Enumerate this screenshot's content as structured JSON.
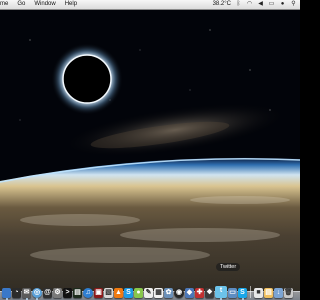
{
  "menubar": {
    "items": [
      {
        "label": "me"
      },
      {
        "label": "Go"
      },
      {
        "label": "Window"
      },
      {
        "label": "Help"
      }
    ],
    "temperature": "38.2°C"
  },
  "dock": {
    "tooltip": "Twitter",
    "items": [
      {
        "name": "finder-icon",
        "color": "#3a78c8",
        "glyph": ""
      },
      {
        "name": "dashboard-icon",
        "color": "#2b2b2b",
        "glyph": "◔"
      },
      {
        "name": "mail-icon",
        "color": "#5b5b5b",
        "glyph": "✉"
      },
      {
        "name": "safari-icon",
        "color": "#5aa0d8",
        "glyph": "◎"
      },
      {
        "name": "address-book-icon",
        "color": "#2f2f2f",
        "glyph": "@"
      },
      {
        "name": "system-preferences-icon",
        "color": "#7a7a7a",
        "glyph": "⚙"
      },
      {
        "name": "terminal-icon",
        "color": "#111111",
        "glyph": ">"
      },
      {
        "name": "activity-monitor-icon",
        "color": "#1c2b1c",
        "glyph": "▤"
      },
      {
        "name": "itunes-icon",
        "color": "#2f7fd1",
        "glyph": "♫"
      },
      {
        "name": "photo-booth-icon",
        "color": "#8c1a1a",
        "glyph": "▣"
      },
      {
        "name": "preview-icon",
        "color": "#d8d8d8",
        "glyph": "▧"
      },
      {
        "name": "vlc-icon",
        "color": "#f07a10",
        "glyph": "▲"
      },
      {
        "name": "skype-icon",
        "color": "#1d9be6",
        "glyph": "S"
      },
      {
        "name": "adium-icon",
        "color": "#88c64c",
        "glyph": "●"
      },
      {
        "name": "textedit-icon",
        "color": "#eeeeee",
        "glyph": "✎"
      },
      {
        "name": "calendar-icon",
        "color": "#f2f2f2",
        "glyph": "▦"
      },
      {
        "name": "iphoto-icon",
        "color": "#6a8fb8",
        "glyph": "✿"
      },
      {
        "name": "aperture-icon",
        "color": "#262626",
        "glyph": "◉"
      },
      {
        "name": "app-icon",
        "color": "#4b77b8",
        "glyph": "◆"
      },
      {
        "name": "app-icon",
        "color": "#c03030",
        "glyph": "✚"
      },
      {
        "name": "app-icon",
        "color": "#3b3b3b",
        "glyph": "❖"
      },
      {
        "name": "twitter-icon",
        "color": "#6cc3ea",
        "glyph": "t"
      },
      {
        "name": "monitor-icon",
        "color": "#5e8dc2",
        "glyph": "▭"
      },
      {
        "name": "skype-icon",
        "color": "#1aa7e8",
        "glyph": "S"
      },
      {
        "name": "folder-icon",
        "color": "#e8e8e8",
        "glyph": "■"
      },
      {
        "name": "documents-icon",
        "color": "#f0c060",
        "glyph": "▤"
      },
      {
        "name": "downloads-icon",
        "color": "#7ba4d4",
        "glyph": "↓"
      },
      {
        "name": "trash-icon",
        "color": "#c8c8c8",
        "glyph": "🗑"
      }
    ]
  }
}
